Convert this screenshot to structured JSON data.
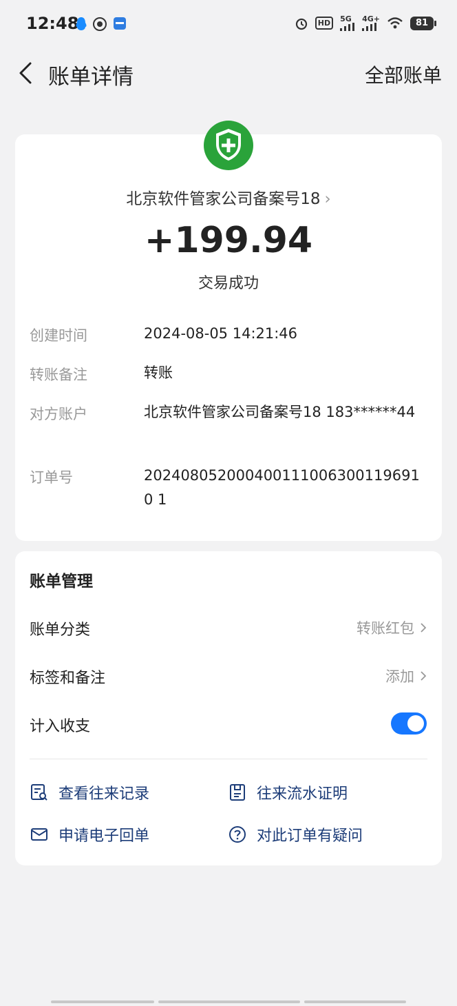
{
  "status_bar": {
    "time": "12:48",
    "network_1": "5G",
    "network_2": "4G+",
    "hd_label": "HD",
    "battery": "81"
  },
  "header": {
    "title": "账单详情",
    "right_link": "全部账单"
  },
  "transaction": {
    "payee": "北京软件管家公司备案号18",
    "amount": "+199.94",
    "status": "交易成功",
    "icon_color": "#2aa33a"
  },
  "details": [
    {
      "label": "创建时间",
      "value": "2024-08-05 14:21:46"
    },
    {
      "label": "转账备注",
      "value": "转账"
    },
    {
      "label": "对方账户",
      "value": "北京软件管家公司备案号18 183******44"
    },
    {
      "label": "订单号",
      "value": "2024080520004001110063001196910 1"
    }
  ],
  "management": {
    "title": "账单管理",
    "category_label": "账单分类",
    "category_value": "转账红包",
    "tags_label": "标签和备注",
    "tags_value": "添加",
    "include_label": "计入收支",
    "include_on": true,
    "accent_color": "#1677ff"
  },
  "actions": {
    "history": "查看往来记录",
    "flow_proof": "往来流水证明",
    "receipt": "申请电子回单",
    "question": "对此订单有疑问"
  }
}
